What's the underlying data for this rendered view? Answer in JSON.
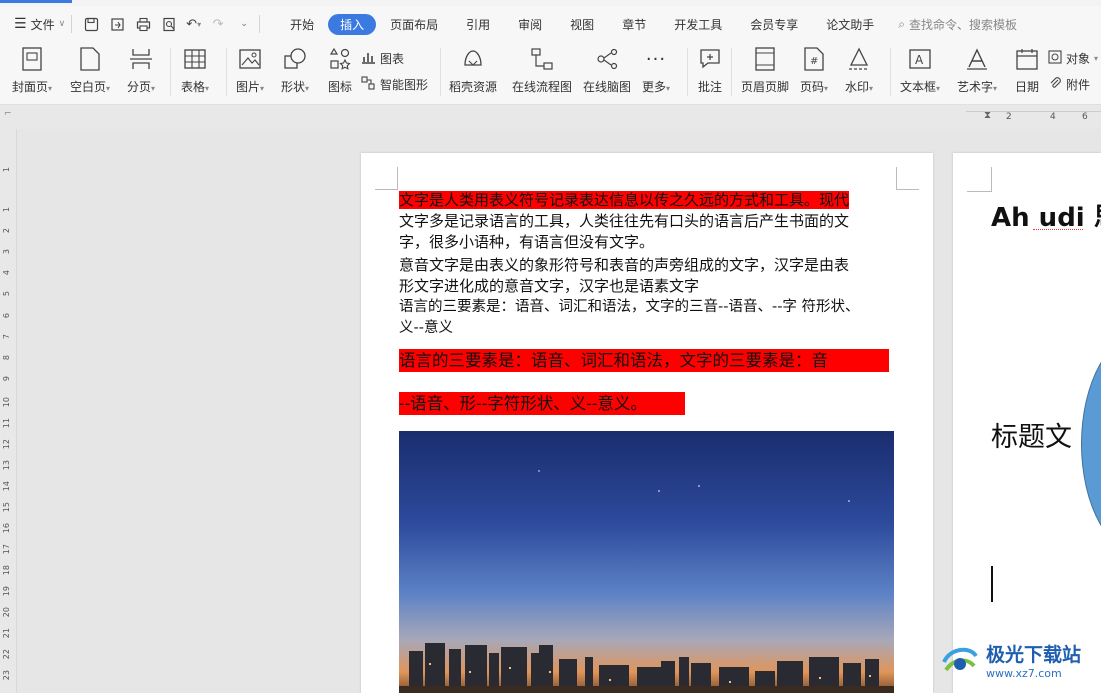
{
  "menu": {
    "file_label": "文件",
    "tabs": [
      "开始",
      "插入",
      "页面布局",
      "引用",
      "审阅",
      "视图",
      "章节",
      "开发工具",
      "会员专享",
      "论文助手"
    ],
    "active_tab": "插入",
    "search_placeholder": "查找命令、搜索模板"
  },
  "ribbon": {
    "cover": "封面页",
    "blank": "空白页",
    "pagebreak": "分页",
    "table": "表格",
    "picture": "图片",
    "shape": "形状",
    "icon": "图标",
    "chart": "图表",
    "smartart": "智能图形",
    "resources": "稻壳资源",
    "flowchart": "在线流程图",
    "mindmap": "在线脑图",
    "more": "更多",
    "comment": "批注",
    "header_footer": "页眉页脚",
    "page_number": "页码",
    "watermark": "水印",
    "textbox": "文本框",
    "wordart": "艺术字",
    "date": "日期",
    "object": "对象",
    "attachment": "附件"
  },
  "ruler": {
    "h_ticks": [
      "2",
      "2",
      "4",
      "6"
    ],
    "v_ticks": [
      "1",
      "1",
      "2",
      "3",
      "4",
      "5",
      "6",
      "7",
      "8",
      "9",
      "10",
      "11",
      "12",
      "13",
      "14",
      "15",
      "16",
      "17",
      "18",
      "19",
      "20",
      "21",
      "22",
      "23"
    ]
  },
  "document": {
    "p1_highlight": "文字是人类用表义符号记录表达信息以传之久远的方式和工具。现代",
    "p1_rest_line1": "文字多是记录语言的工具，人类往往先有口头的语言后产生书面的文",
    "p1_rest_line2": "字，很多小语种，有语言但没有文字。",
    "p2_line1": "意音文字是由表义的象形符号和表音的声旁组成的文字，汉字是由表",
    "p2_line2": "形文字进化成的意音文字，汉字也是语素文字",
    "p3_line1": "语言的三要素是：语音、词汇和语法，文字的三音--语音、--字 符形状、",
    "p3_line2": "义--意义",
    "red_line1": "语言的三要素是：语音、词汇和语法，文字的三要素是：音",
    "red_line2": "--语音、形--字符形状、义--意义。"
  },
  "page2": {
    "heading": "Ah udi 思",
    "title": "标题文"
  },
  "watermark": {
    "name": "极光下载站",
    "url": "www.xz7.com"
  },
  "colors": {
    "accent": "#3b7ae0",
    "highlight": "#ff0000"
  }
}
